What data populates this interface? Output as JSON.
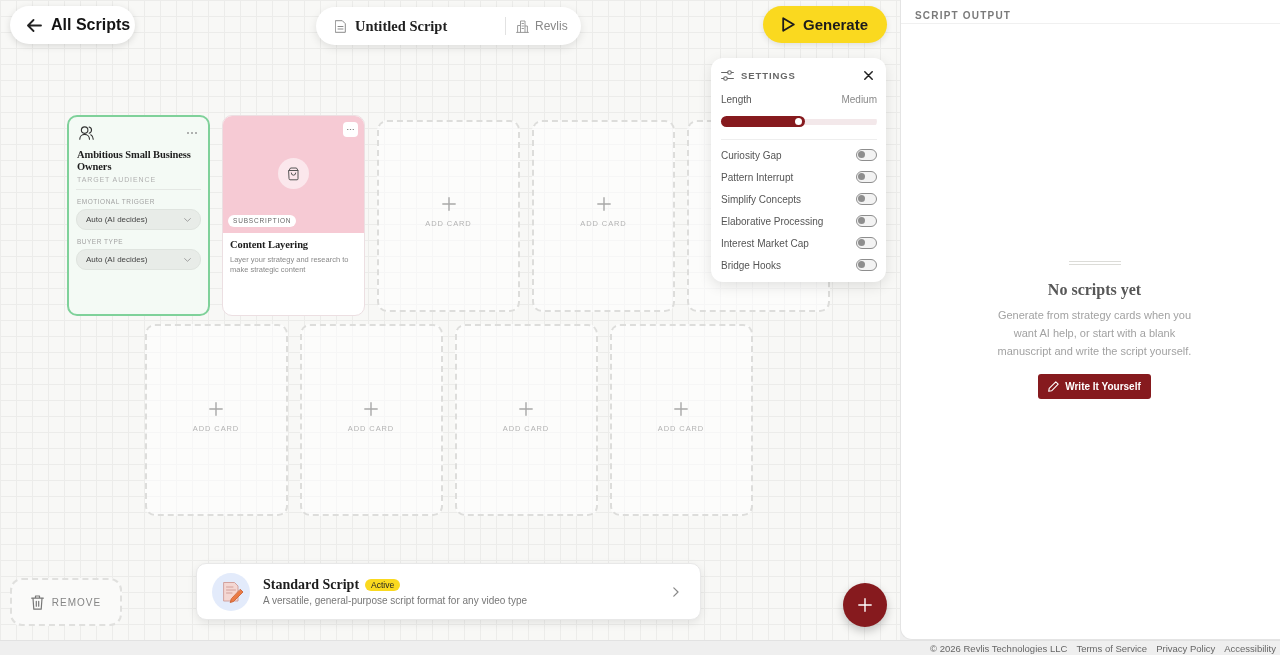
{
  "top_bar": {
    "back_button": {
      "label": "All Scripts"
    },
    "script": {
      "title": "Untitled Script",
      "workspace": "Revlis"
    },
    "generate_button": {
      "label": "Generate"
    }
  },
  "settings": {
    "title": "SETTINGS",
    "length": {
      "label": "Length",
      "value": "Medium",
      "level": 0.54
    },
    "toggles": [
      {
        "label": "Curiosity Gap",
        "on": false
      },
      {
        "label": "Pattern Interrupt",
        "on": false
      },
      {
        "label": "Simplify Concepts",
        "on": false
      },
      {
        "label": "Elaborative Processing",
        "on": false
      },
      {
        "label": "Interest Market Cap",
        "on": false
      },
      {
        "label": "Bridge Hooks",
        "on": false
      }
    ]
  },
  "card_rows": [
    {
      "cards": [
        {
          "kind": "audience",
          "selected": true,
          "title": "Ambitious Small Business Owners",
          "subtitle": "TARGET AUDIENCE",
          "fields": [
            {
              "label": "EMOTIONAL TRIGGER",
              "value": "Auto (AI decides)"
            },
            {
              "label": "BUYER TYPE",
              "value": "Auto (AI decides)"
            }
          ]
        },
        {
          "kind": "strategy",
          "selected": false,
          "color": "#f6cad4",
          "tag": "SUBSCRIPTION",
          "title": "Content Layering",
          "description": "Layer your strategy and research to make strategic content"
        },
        {
          "kind": "empty",
          "selected": false,
          "label": "ADD CARD"
        },
        {
          "kind": "empty",
          "selected": false,
          "label": "ADD CARD"
        },
        {
          "kind": "empty",
          "selected": false
        }
      ]
    },
    {
      "cards": [
        {
          "kind": "empty",
          "selected": false,
          "label": "ADD CARD"
        },
        {
          "kind": "empty",
          "selected": false,
          "label": "ADD CARD"
        },
        {
          "kind": "empty",
          "selected": false,
          "label": "ADD CARD"
        },
        {
          "kind": "empty",
          "selected": false,
          "label": "ADD CARD"
        }
      ]
    }
  ],
  "remove_button": {
    "label": "REMOVE"
  },
  "script_type": {
    "title": "Standard Script",
    "badge": "Active",
    "description": "A versatile, general-purpose script format for any video type"
  },
  "output_panel": {
    "title": "SCRIPT OUTPUT",
    "empty_state": {
      "title": "No scripts yet",
      "message": "Generate from strategy cards when you want AI help, or start with a blank manuscript and write the script yourself.",
      "button": "Write It Yourself"
    }
  },
  "footer": {
    "copyright": "© 2026 Revlis Technologies LLC",
    "links": [
      "Terms of Service",
      "Privacy Policy",
      "Accessibility"
    ]
  }
}
